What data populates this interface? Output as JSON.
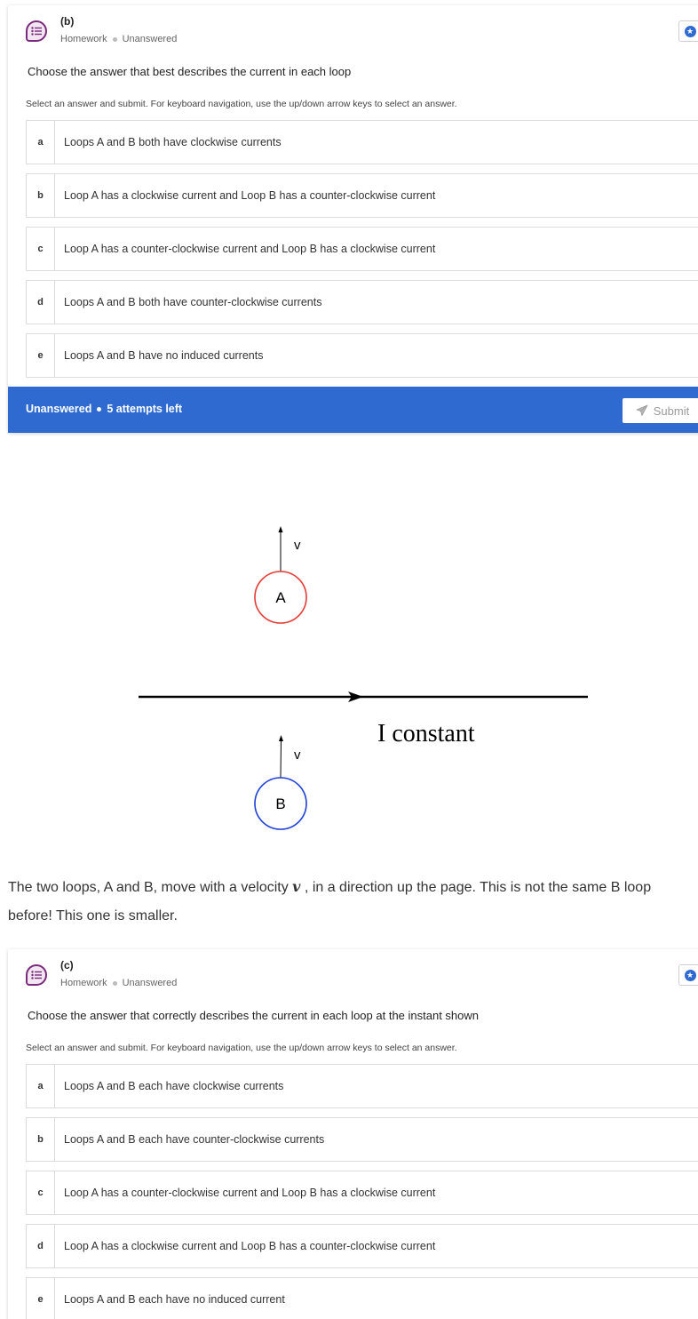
{
  "colors": {
    "accent": "#2f6ad0",
    "loop_a": "#e53935",
    "loop_b": "#1e3fd6",
    "icon": "#7a2a7a"
  },
  "part_b": {
    "part_label": "(b)",
    "meta": [
      "Homework",
      "Unanswered"
    ],
    "prompt": "Choose the answer that best describes the current in each loop",
    "instruction": "Select an answer and submit. For keyboard navigation, use the up/down arrow keys to select an answer.",
    "options": [
      {
        "letter": "a",
        "text": "Loops A and B both have clockwise currents"
      },
      {
        "letter": "b",
        "text": "Loop A has a clockwise current and Loop B has a counter-clockwise current"
      },
      {
        "letter": "c",
        "text": "Loop A has a counter-clockwise current and Loop B has a clockwise current"
      },
      {
        "letter": "d",
        "text": "Loops A and B both have counter-clockwise currents"
      },
      {
        "letter": "e",
        "text": "Loops A and B have no induced currents"
      }
    ],
    "footer": {
      "status": "Unanswered",
      "attempts": "5 attempts left",
      "submit": "Submit"
    }
  },
  "figure": {
    "loop_a_label": "A",
    "loop_b_label": "B",
    "velocity_label": "v",
    "wire_label": "I constant"
  },
  "description": {
    "line1_before": "The two loops, A and B, move with a velocity",
    "symbol": "v",
    "line1_after": ", in a direction up the page. This is not the same B loop",
    "line2": "before! This one is smaller."
  },
  "part_c": {
    "part_label": "(c)",
    "meta": [
      "Homework",
      "Unanswered"
    ],
    "prompt": "Choose the answer that correctly describes the current in each loop at the instant shown",
    "instruction": "Select an answer and submit. For keyboard navigation, use the up/down arrow keys to select an answer.",
    "options": [
      {
        "letter": "a",
        "text": "Loops A and B each have clockwise currents"
      },
      {
        "letter": "b",
        "text": "Loops A and B each have counter-clockwise currents"
      },
      {
        "letter": "c",
        "text": "Loop A has a counter-clockwise current and Loop B has a clockwise current"
      },
      {
        "letter": "d",
        "text": "Loop A has a clockwise current and Loop B has a counter-clockwise current"
      },
      {
        "letter": "e",
        "text": "Loops A and B each have no induced current"
      }
    ]
  }
}
